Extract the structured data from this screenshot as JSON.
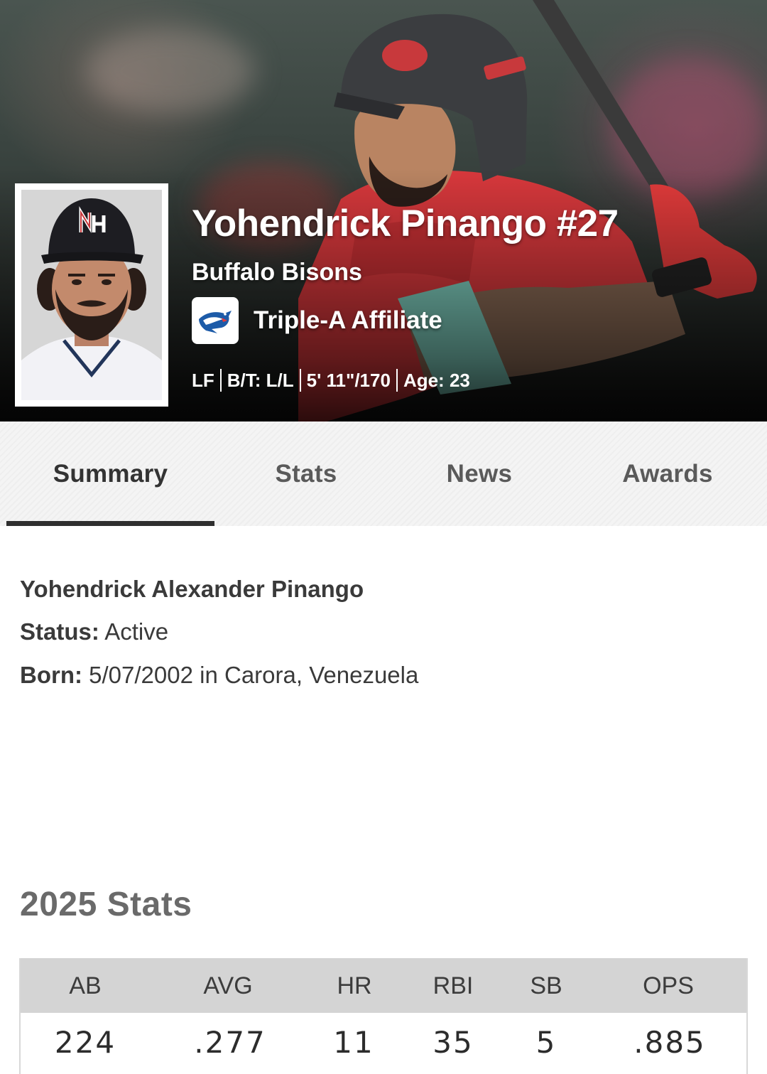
{
  "player": {
    "name": "Yohendrick Pinango #27",
    "team": "Buffalo Bisons",
    "affiliate": "Triple-A Affiliate",
    "bio": {
      "position": "LF",
      "bats_throws": "B/T: L/L",
      "height_weight": "5' 11\"/170",
      "age": "Age: 23"
    }
  },
  "tabs": [
    {
      "label": "Summary",
      "active": true
    },
    {
      "label": "Stats",
      "active": false
    },
    {
      "label": "News",
      "active": false
    },
    {
      "label": "Awards",
      "active": false
    }
  ],
  "summary": {
    "full_name": "Yohendrick Alexander Pinango",
    "status_label": "Status:",
    "status_value": "Active",
    "born_label": "Born:",
    "born_value": "5/07/2002 in Carora, Venezuela"
  },
  "stats": {
    "heading": "2025 Stats",
    "columns": [
      {
        "label": "AB",
        "value": "224"
      },
      {
        "label": "AVG",
        "value": ".277"
      },
      {
        "label": "HR",
        "value": "11"
      },
      {
        "label": "RBI",
        "value": "35"
      },
      {
        "label": "SB",
        "value": "5"
      },
      {
        "label": "OPS",
        "value": ".885"
      }
    ]
  },
  "icons": {
    "affiliate_logo": "blue-jays-logo",
    "headshot_cap_logo": "nh-cap-logo"
  },
  "colors": {
    "jersey_red": "#d8383c",
    "tab_underline": "#2f2f2f",
    "table_header_bg": "#d4d4d4"
  }
}
